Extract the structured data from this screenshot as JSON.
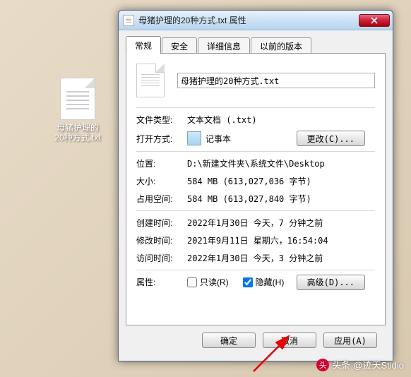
{
  "desktop": {
    "icon_label": "母猪护理的\n20种方式.txt"
  },
  "dialog": {
    "title": "母猪护理的20种方式.txt 属性",
    "tabs": [
      "常规",
      "安全",
      "详细信息",
      "以前的版本"
    ],
    "filename": "母猪护理的20种方式.txt",
    "rows": {
      "filetype_label": "文件类型:",
      "filetype_value": "文本文档 (.txt)",
      "openwith_label": "打开方式:",
      "openwith_value": "记事本",
      "change_btn": "更改(C)...",
      "location_label": "位置:",
      "location_value": "D:\\新建文件夹\\系统文件\\Desktop",
      "size_label": "大小:",
      "size_value": "584 MB (613,027,036 字节)",
      "diskspace_label": "占用空间:",
      "diskspace_value": "584 MB (613,027,840 字节)",
      "created_label": "创建时间:",
      "created_value": "2022年1月30日 今天，7 分钟之前",
      "modified_label": "修改时间:",
      "modified_value": "2021年9月11日 星期六，16:54:04",
      "accessed_label": "访问时间:",
      "accessed_value": "2022年1月30日 今天，3 分钟之前",
      "attr_label": "属性:",
      "readonly_label": "只读(R)",
      "hidden_label": "隐藏(H)",
      "advanced_btn": "高级(D)..."
    },
    "buttons": {
      "ok": "确定",
      "cancel": "取消",
      "apply": "应用(A)"
    }
  },
  "watermark": {
    "text": "头条",
    "author": "@迹天Stidio"
  }
}
